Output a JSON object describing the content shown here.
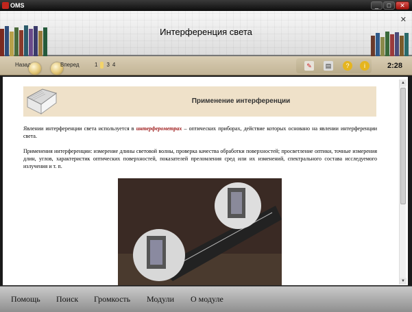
{
  "window": {
    "title": "OMS"
  },
  "header": {
    "title": "Интерференция света"
  },
  "nav": {
    "back_label": "Назад",
    "forward_label": "Вперед",
    "pages": [
      "1",
      "2",
      "3",
      "4"
    ],
    "current_page": "2",
    "timer": "2:28"
  },
  "toolbar_icons": [
    "bookmark-icon",
    "print-icon",
    "help-icon",
    "info-icon"
  ],
  "content": {
    "section_title": "Применение интерференции",
    "p1_before": "Явлении интерференции света используется в ",
    "p1_term": "интерферометрах",
    "p1_after": " – оптических приборах, действие которых основано на явлении интерференции света.",
    "p2": "Применения интерференции: измерение длины световой волны, проверка качества обработки поверхностей; просветление оптики, точные измерения длин, углов, характеристик оптических поверхностей, показателей преломления сред или их изменений, спектрального состава исследуемого излучения и т. п."
  },
  "bottom_menu": {
    "help": "Помощь",
    "search": "Поиск",
    "volume": "Громкость",
    "modules": "Модули",
    "about": "О модуле"
  },
  "colors": {
    "accent_term": "#9b1414",
    "section_bg": "#efe1c9",
    "navbar_bg": "#c9bc9f"
  }
}
